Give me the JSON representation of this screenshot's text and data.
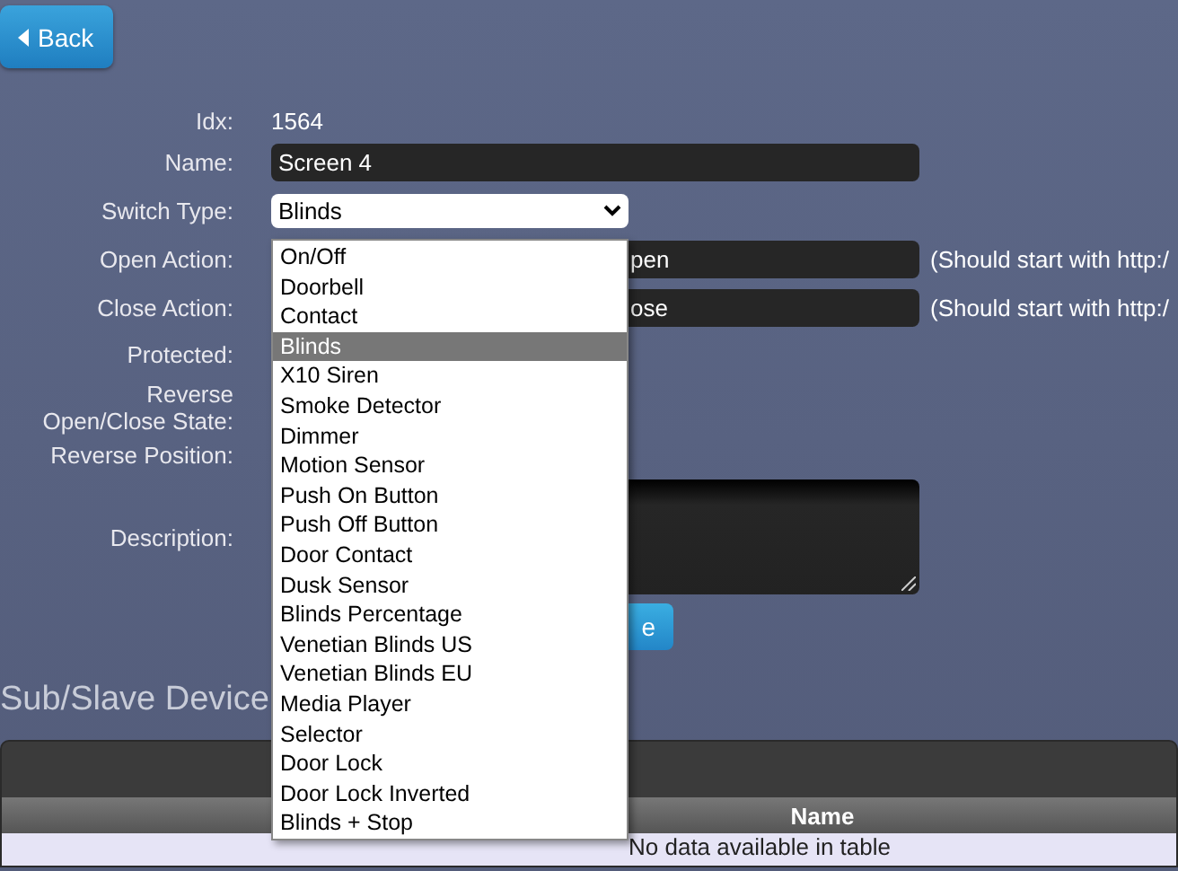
{
  "back_button": {
    "label": "Back"
  },
  "form": {
    "idx_label": "Idx:",
    "idx": "1564",
    "name_label": "Name:",
    "name": "Screen 4",
    "switch_type_label": "Switch Type:",
    "switch_type": "Blinds",
    "open_action_label": "Open Action:",
    "open_action": "pen",
    "open_action_hint": "(Should start with http:/",
    "close_action_label": "Close Action:",
    "close_action": "ose",
    "close_action_hint": "(Should start with http:/",
    "protected_label": "Protected:",
    "reverse_state_label": [
      "Reverse",
      "Open/Close State:"
    ],
    "reverse_position_label": "Reverse Position:",
    "description_label": "Description:",
    "save_button": "e"
  },
  "dropdown": {
    "options": [
      {
        "label": "On/Off",
        "selected": false
      },
      {
        "label": "Doorbell",
        "selected": false
      },
      {
        "label": "Contact",
        "selected": false
      },
      {
        "label": "Blinds",
        "selected": true
      },
      {
        "label": "X10 Siren",
        "selected": false
      },
      {
        "label": "Smoke Detector",
        "selected": false
      },
      {
        "label": "Dimmer",
        "selected": false
      },
      {
        "label": "Motion Sensor",
        "selected": false
      },
      {
        "label": "Push On Button",
        "selected": false
      },
      {
        "label": "Push Off Button",
        "selected": false
      },
      {
        "label": "Door Contact",
        "selected": false
      },
      {
        "label": "Dusk Sensor",
        "selected": false
      },
      {
        "label": "Blinds Percentage",
        "selected": false
      },
      {
        "label": "Venetian Blinds US",
        "selected": false
      },
      {
        "label": "Venetian Blinds EU",
        "selected": false
      },
      {
        "label": "Media Player",
        "selected": false
      },
      {
        "label": "Selector",
        "selected": false
      },
      {
        "label": "Door Lock",
        "selected": false
      },
      {
        "label": "Door Lock Inverted",
        "selected": false
      },
      {
        "label": "Blinds + Stop",
        "selected": false
      }
    ]
  },
  "sub_devices": {
    "title": "Sub/Slave Device",
    "columns": [
      "Name"
    ],
    "empty_text": "No data available in table"
  }
}
